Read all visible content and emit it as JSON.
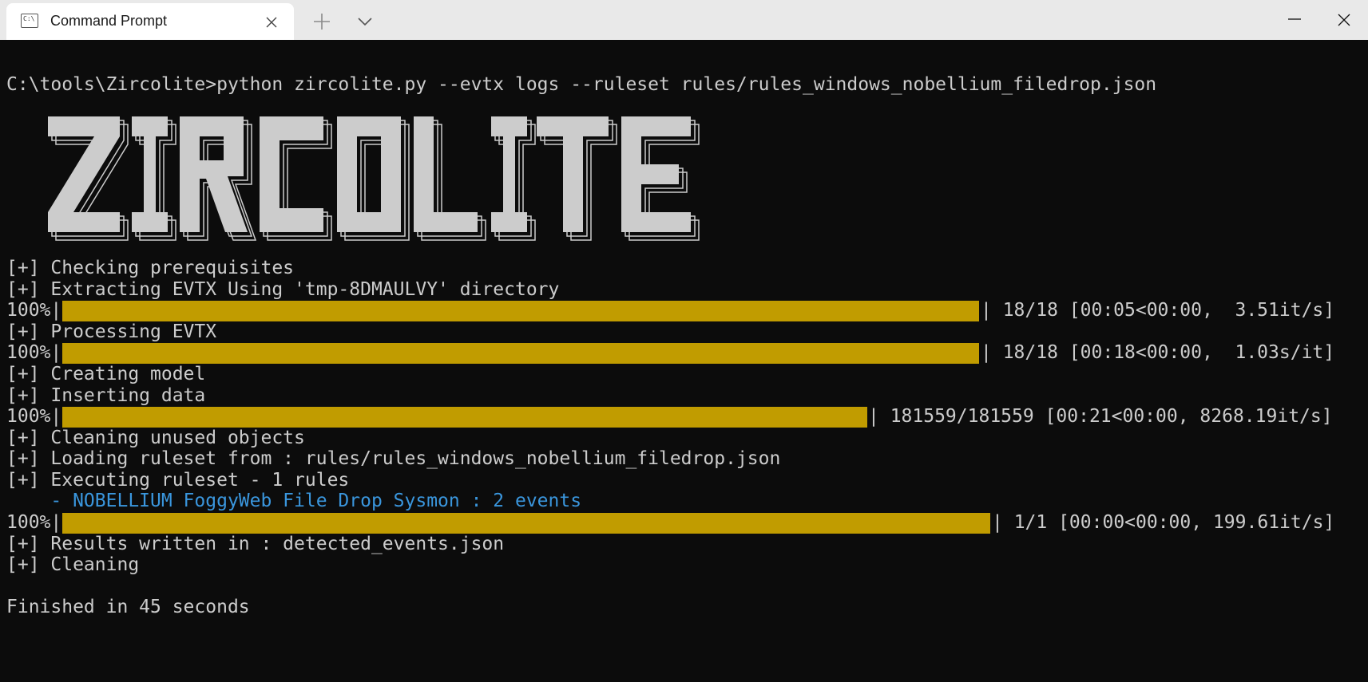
{
  "window": {
    "tab_title": "Command Prompt",
    "tab_icon": "C:\\",
    "icons": {
      "tab": "terminal-icon",
      "close_tab": "close-icon",
      "new_tab": "plus-icon",
      "dropdown": "chevron-down-icon",
      "minimize": "minimize-icon",
      "maximize": "maximize-icon",
      "close": "close-icon"
    }
  },
  "console": {
    "command": "C:\\tools\\Zircolite>python zircolite.py --evtx logs --ruleset rules/rules_windows_nobellium_filedrop.json",
    "banner": "ZIRCOLITE",
    "lines": {
      "prereq": "[+] Checking prerequisites",
      "extract": "[+] Extracting EVTX Using 'tmp-8DMAULVY' directory",
      "processing": "[+] Processing EVTX",
      "model": "[+] Creating model",
      "inserting": "[+] Inserting data",
      "cleaning_unused": "[+] Cleaning unused objects",
      "loading": "[+] Loading ruleset from : rules/rules_windows_nobellium_filedrop.json",
      "executing": "[+] Executing ruleset - 1 rules",
      "rule_hit": "    - NOBELLIUM FoggyWeb File Drop Sysmon : 2 events",
      "results": "[+] Results written in : detected_events.json",
      "cleaning": "[+] Cleaning",
      "finished": "Finished in 45 seconds"
    },
    "progress": [
      {
        "prefix": "100%|",
        "progress": 1.0,
        "suffix": "| 18/18 [00:05<00:00,  3.51it/s]"
      },
      {
        "prefix": "100%|",
        "progress": 1.0,
        "suffix": "| 18/18 [00:18<00:00,  1.03s/it]"
      },
      {
        "prefix": "100%|",
        "progress": 1.0,
        "suffix": "| 181559/181559 [00:21<00:00, 8268.19it/s]"
      },
      {
        "prefix": "100%|",
        "progress": 1.0,
        "suffix": "| 1/1 [00:00<00:00, 199.61it/s]"
      }
    ]
  },
  "colors": {
    "background": "#0c0c0c",
    "text": "#cccccc",
    "progress_bar": "#c19c00",
    "highlight": "#3a96dd",
    "titlebar": "#e9e9e9"
  }
}
